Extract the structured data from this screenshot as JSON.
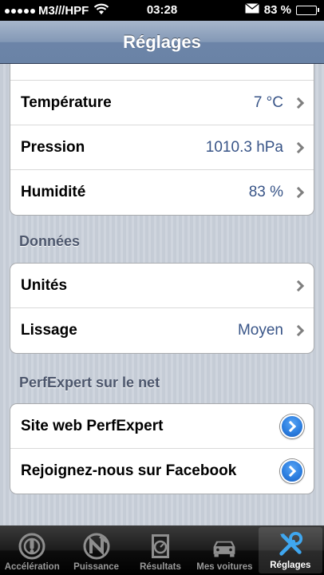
{
  "status_bar": {
    "carrier": "M3///HPF",
    "time": "03:28",
    "battery": "83 %",
    "battery_level": 0.83
  },
  "nav": {
    "title": "Réglages"
  },
  "sensor_group": [
    {
      "label": "Température",
      "value": "7 °C"
    },
    {
      "label": "Pression",
      "value": "1010.3 hPa"
    },
    {
      "label": "Humidité",
      "value": "83 %"
    }
  ],
  "data_section": {
    "header": "Données",
    "rows": [
      {
        "label": "Unités",
        "value": ""
      },
      {
        "label": "Lissage",
        "value": "Moyen"
      }
    ]
  },
  "web_section": {
    "header": "PerfExpert sur le net",
    "rows": [
      {
        "label": "Site web PerfExpert"
      },
      {
        "label": "Rejoignez-nous sur Facebook"
      }
    ]
  },
  "tab_bar": [
    {
      "label": "Accélération",
      "icon": "acceleration-icon",
      "active": false
    },
    {
      "label": "Puissance",
      "icon": "power-icon",
      "active": false
    },
    {
      "label": "Résultats",
      "icon": "results-icon",
      "active": false
    },
    {
      "label": "Mes voitures",
      "icon": "car-icon",
      "active": false
    },
    {
      "label": "Réglages",
      "icon": "settings-tools-icon",
      "active": true
    }
  ],
  "colors": {
    "value_text": "#385487",
    "disclosure_blue": "#2d7fe0",
    "nav_bar": "#8398b6"
  }
}
